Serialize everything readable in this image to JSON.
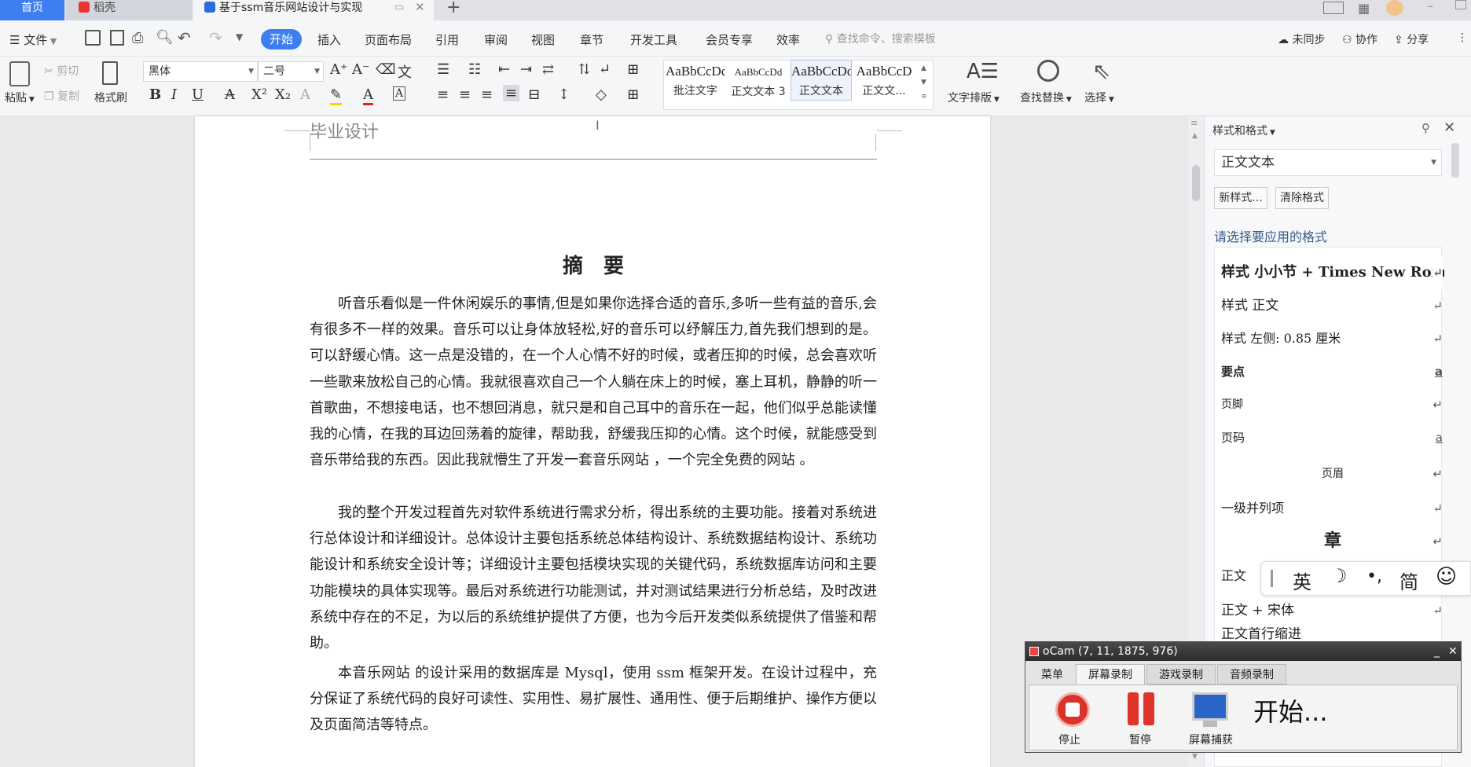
{
  "tabs": {
    "home": "首页",
    "daoke": "稻壳",
    "doc": "基于ssm音乐网站设计与实现"
  },
  "menu": {
    "file": "文件",
    "items": [
      "开始",
      "插入",
      "页面布局",
      "引用",
      "审阅",
      "视图",
      "章节",
      "开发工具",
      "会员专享",
      "效率"
    ],
    "search_placeholder": "查找命令、搜索模板",
    "sync": "未同步",
    "collab": "协作",
    "share": "分享"
  },
  "ribbon": {
    "paste": "粘贴",
    "cut": "剪切",
    "copy": "复制",
    "format_painter": "格式刷",
    "font_name": "黑体",
    "font_size": "二号",
    "styles": [
      {
        "preview": "AaBbCcDd",
        "name": "批注文字"
      },
      {
        "preview": "AaBbCcDd",
        "name": "正文文本 3"
      },
      {
        "preview": "AaBbCcDd",
        "name": "正文文本"
      },
      {
        "preview": "AaBbCcD",
        "name": "正文文..."
      }
    ],
    "text_layout": "文字排版",
    "find_replace": "查找替换",
    "select": "选择"
  },
  "document": {
    "header_text": "毕业设计",
    "title": "摘　要",
    "paragraphs": [
      "听音乐看似是一件休闲娱乐的事情,但是如果你选择合适的音乐,多听一些有益的音乐,会有很多不一样的效果。音乐可以让身体放轻松,好的音乐可以纾解压力,首先我们想到的是。可以舒缓心情。这一点是没错的，在一个人心情不好的时候，或者压抑的时候，总会喜欢听一些歌来放松自己的心情。我就很喜欢自己一个人躺在床上的时候，塞上耳机，静静的听一首歌曲，不想接电话，也不想回消息，就只是和自己耳中的音乐在一起，他们似乎总能读懂我的心情，在我的耳边回荡着的旋律，帮助我，舒缓我压抑的心情。这个时候，就能感受到音乐带给我的东西。因此我就懵生了开发一套音乐网站 ，一个完全免费的网站 。",
      "我的整个开发过程首先对软件系统进行需求分析，得出系统的主要功能。接着对系统进行总体设计和详细设计。总体设计主要包括系统总体结构设计、系统数据结构设计、系统功能设计和系统安全设计等；详细设计主要包括模块实现的关键代码，系统数据库访问和主要功能模块的具体实现等。最后对系统进行功能测试，并对测试结果进行分析总结，及时改进系统中存在的不足，为以后的系统维护提供了方便，也为今后开发类似系统提供了借鉴和帮助。",
      "本音乐网站 的设计采用的数据库是 Mysql，使用 ssm 框架开发。在设计过程中，充分保证了系统代码的良好可读性、实用性、易扩展性、通用性、便于后期维护、操作方便以及页面简洁等特点。"
    ]
  },
  "panel": {
    "title": "样式和格式",
    "current_style": "正文文本",
    "new_style": "新样式...",
    "clear_format": "清除格式",
    "prompt": "请选择要应用的格式",
    "styles": [
      "样式  小小节 + Times New Roman",
      "样式  正文",
      "样式 左侧:  0.85 厘米",
      "要点",
      "页脚",
      "页码",
      "页眉",
      "一级并列项",
      "章",
      "正文",
      "正文 + 宋体",
      "正文首行缩进"
    ]
  },
  "ime": {
    "lang": "英",
    "punct": "•,",
    "simp": "简"
  },
  "ocam": {
    "title": "oCam (7, 11, 1875, 976)",
    "tabs": [
      "菜单",
      "屏幕录制",
      "游戏录制",
      "音频录制"
    ],
    "stop": "停止",
    "pause": "暂停",
    "capture": "屏幕捕获",
    "status": "开始..."
  }
}
